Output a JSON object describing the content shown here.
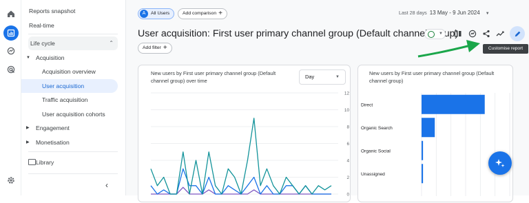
{
  "nav": {
    "rail_icons": [
      "home-icon",
      "reports-icon",
      "explore-icon",
      "advertising-icon",
      "settings-icon"
    ],
    "sidebar": {
      "reports_snapshot": "Reports snapshot",
      "realtime": "Real-time",
      "life_cycle": "Life cycle",
      "acquisition": "Acquisition",
      "acquisition_overview": "Acquisition overview",
      "user_acquisition": "User acquisition",
      "traffic_acquisition": "Traffic acquisition",
      "user_acquisition_cohorts": "User acquisition cohorts",
      "engagement": "Engagement",
      "monetisation": "Monetisation",
      "library": "Library",
      "collapse_label": "‹"
    }
  },
  "toolbar": {
    "audience_initial": "A",
    "audience_label": "All Users",
    "add_comparison": "Add comparison",
    "date_label": "Last 28 days",
    "date_range": "13 May - 9 Jun 2024",
    "add_filter": "Add filter",
    "customise_tooltip": "Customise report",
    "accent_color": "#1a73e8"
  },
  "page": {
    "title": "User acquisition: First user primary channel group (Default channel group)"
  },
  "line_card": {
    "title": "New users by First user primary channel group (Default channel group) over time",
    "granularity": "Day"
  },
  "bar_card": {
    "title": "New users by First user primary channel group (Default channel group)"
  },
  "chart_data": [
    {
      "type": "line",
      "title": "New users by First user primary channel group (Default channel group) over time",
      "y_ticks": [
        "12",
        "10",
        "8",
        "6",
        "4",
        "2",
        "0"
      ],
      "ylim": [
        0,
        12
      ],
      "grid": true,
      "series": [
        {
          "color": "#12939a",
          "values": [
            3,
            1,
            2,
            0,
            0,
            5,
            0,
            4,
            0,
            5,
            1,
            0,
            3,
            2,
            0,
            4,
            9,
            1,
            3,
            1,
            0,
            2,
            1,
            0,
            1,
            0,
            1,
            0.5,
            1
          ]
        },
        {
          "color": "#1a73e8",
          "values": [
            1,
            0,
            0.5,
            0,
            0,
            3,
            1,
            1,
            0,
            2,
            0,
            0,
            1,
            0.5,
            0,
            1,
            2,
            0,
            1,
            0,
            0,
            1,
            1,
            0,
            1,
            0,
            0,
            0,
            0
          ]
        },
        {
          "color": "#7e57c2",
          "values": [
            0,
            0,
            0,
            0,
            0,
            0.8,
            0,
            0,
            0,
            0.5,
            0,
            0,
            0,
            0,
            0,
            0,
            0.5,
            0,
            0,
            0,
            0,
            0,
            0,
            0,
            0,
            0,
            0,
            0,
            0
          ]
        }
      ]
    },
    {
      "type": "bar",
      "title": "New users by First user primary channel group (Default channel group)",
      "categories": [
        "Direct",
        "Organic Search",
        "Organic Social",
        "Unassigned"
      ],
      "values": [
        43,
        9,
        1,
        1
      ],
      "xlim": [
        0,
        60
      ],
      "color": "#1a73e8"
    }
  ]
}
